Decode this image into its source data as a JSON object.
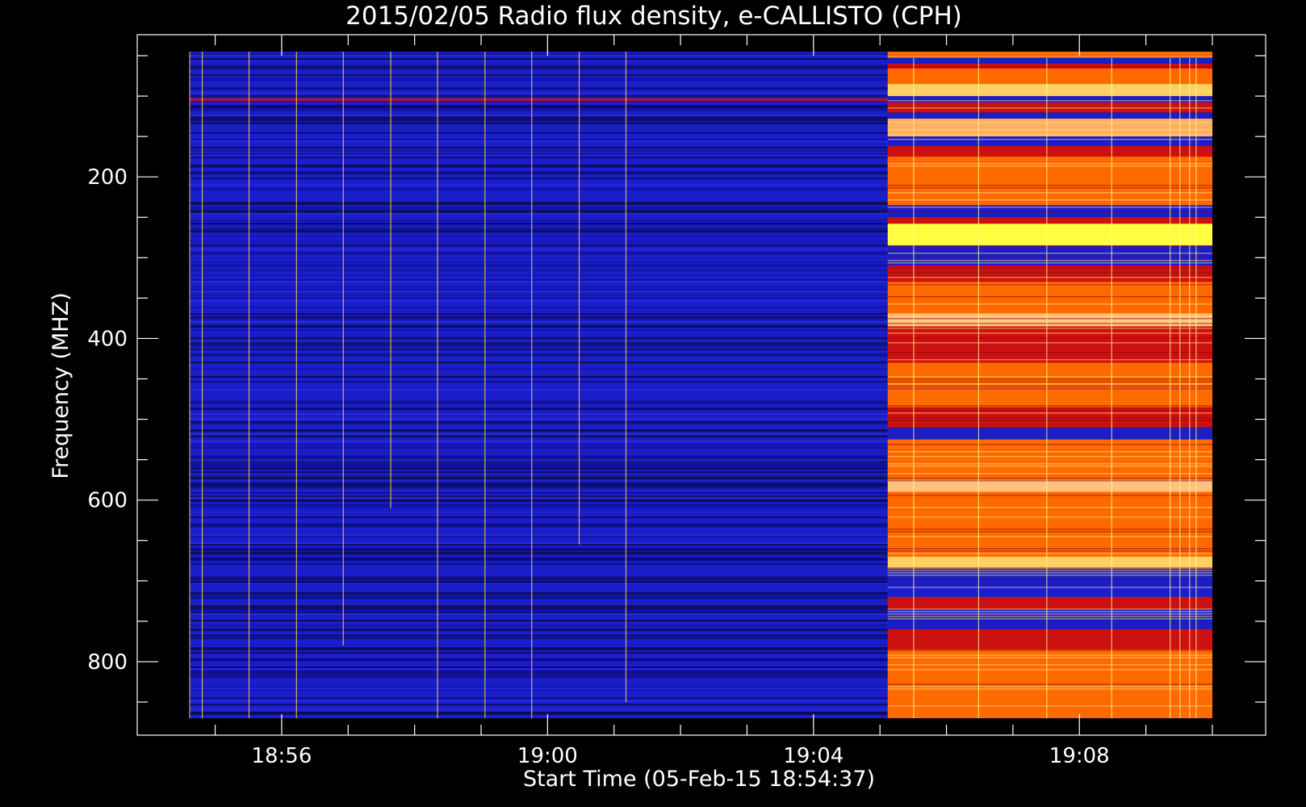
{
  "chart_data": {
    "type": "heatmap",
    "title": "2015/02/05  Radio flux density, e-CALLISTO (CPH)",
    "xlabel": "Start Time (05-Feb-15 18:54:37)",
    "ylabel": "Frequency (MHZ)",
    "x_range": [
      "18:54:37",
      "19:10:00"
    ],
    "y_range_mhz": [
      45,
      870
    ],
    "y_inverted": true,
    "x_ticks": [
      "18:56",
      "19:00",
      "19:04",
      "19:08"
    ],
    "y_ticks": [
      200,
      400,
      600,
      800
    ],
    "regions": [
      {
        "name": "background",
        "x_start": "18:54:37",
        "x_end": "19:05:07",
        "level": "low",
        "color": "#1a1ec8"
      },
      {
        "name": "high-intensity",
        "x_start": "19:05:07",
        "x_end": "19:10:00",
        "level": "high",
        "color": "#ff3010"
      }
    ],
    "colors": {
      "low": "#1a1ec8",
      "dark": "#0a0a50",
      "mid": "#cc1010",
      "high": "#ff6a00",
      "peak": "#ffff40"
    }
  }
}
